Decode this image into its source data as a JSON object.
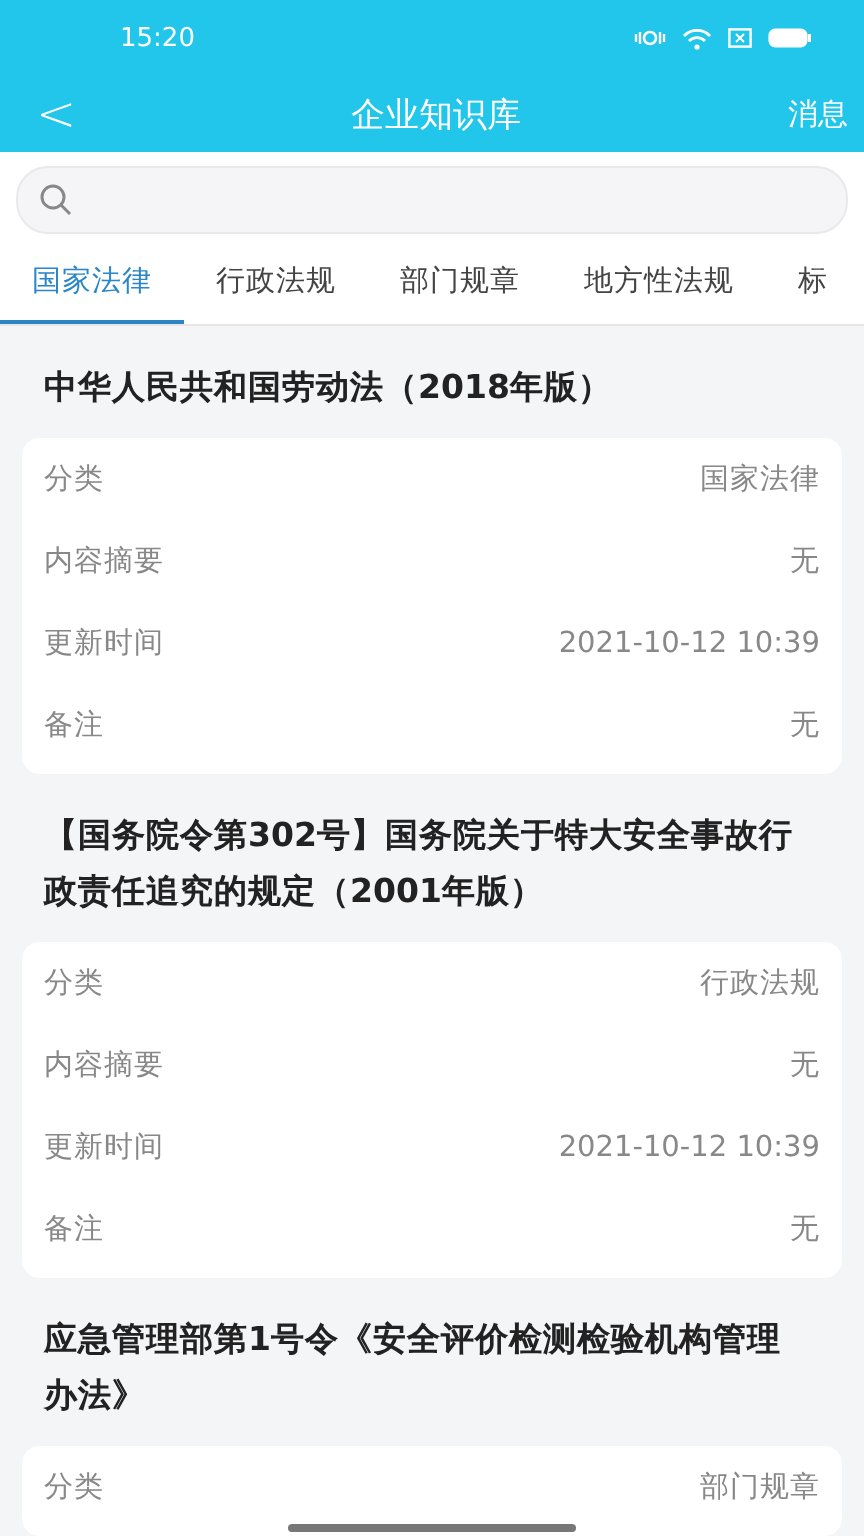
{
  "status_bar": {
    "time": "15:20"
  },
  "header": {
    "back": "<",
    "title": "企业知识库",
    "action": "消息"
  },
  "tabs": [
    {
      "label": "国家法律",
      "selected": true
    },
    {
      "label": "行政法规",
      "selected": false
    },
    {
      "label": "部门规章",
      "selected": false
    },
    {
      "label": "地方性法规",
      "selected": false
    },
    {
      "label": "标",
      "selected": false
    }
  ],
  "items": [
    {
      "title": "中华人民共和国劳动法（2018年版）",
      "fields": [
        {
          "label": "分类",
          "value": "国家法律"
        },
        {
          "label": "内容摘要",
          "value": "无"
        },
        {
          "label": "更新时间",
          "value": "2021-10-12 10:39"
        },
        {
          "label": "备注",
          "value": "无"
        }
      ]
    },
    {
      "title": "【国务院令第302号】国务院关于特大安全事故行政责任追究的规定（2001年版）",
      "fields": [
        {
          "label": "分类",
          "value": "行政法规"
        },
        {
          "label": "内容摘要",
          "value": "无"
        },
        {
          "label": "更新时间",
          "value": "2021-10-12 10:39"
        },
        {
          "label": "备注",
          "value": "无"
        }
      ]
    },
    {
      "title": "应急管理部第1号令《安全评价检测检验机构管理办法》",
      "fields": [
        {
          "label": "分类",
          "value": "部门规章"
        }
      ]
    }
  ]
}
